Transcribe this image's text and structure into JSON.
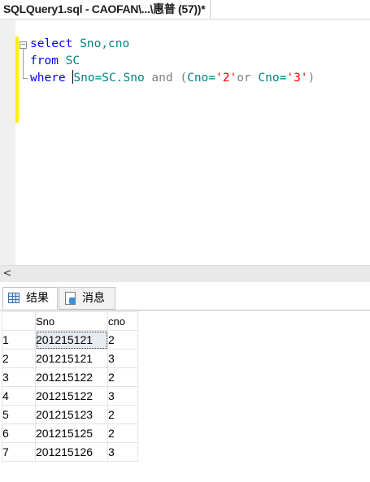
{
  "document_tab": {
    "title": "SQLQuery1.sql - CAOFAN\\...\\惠普 (57))*"
  },
  "editor": {
    "line1": {
      "kw": "select",
      "rest": " Sno,cno"
    },
    "line2": {
      "kw": "from",
      "rest": " SC"
    },
    "line3": {
      "kw": "where",
      "sp": " ",
      "a": "Sno=SC.Sno",
      "and": " and (",
      "cno1": "Cno=",
      "v1": "'2'",
      "or": "or ",
      "cno2": "Cno=",
      "v2": "'3'",
      "close": ")"
    }
  },
  "scrollbar": {
    "left_arrow": "<"
  },
  "results_tabs": {
    "results_label": "结果",
    "messages_label": "消息"
  },
  "grid": {
    "columns": [
      "",
      "Sno",
      "cno"
    ],
    "rows": [
      {
        "n": "1",
        "sno": "201215121",
        "cno": "2"
      },
      {
        "n": "2",
        "sno": "201215121",
        "cno": "3"
      },
      {
        "n": "3",
        "sno": "201215122",
        "cno": "2"
      },
      {
        "n": "4",
        "sno": "201215122",
        "cno": "3"
      },
      {
        "n": "5",
        "sno": "201215123",
        "cno": "2"
      },
      {
        "n": "6",
        "sno": "201215125",
        "cno": "2"
      },
      {
        "n": "7",
        "sno": "201215126",
        "cno": "3"
      }
    ]
  },
  "colors": {
    "keyword": "#0000ff",
    "identifier": "#008080",
    "operator": "#808080",
    "string": "#ff0000",
    "change_bar": "#fff200"
  }
}
